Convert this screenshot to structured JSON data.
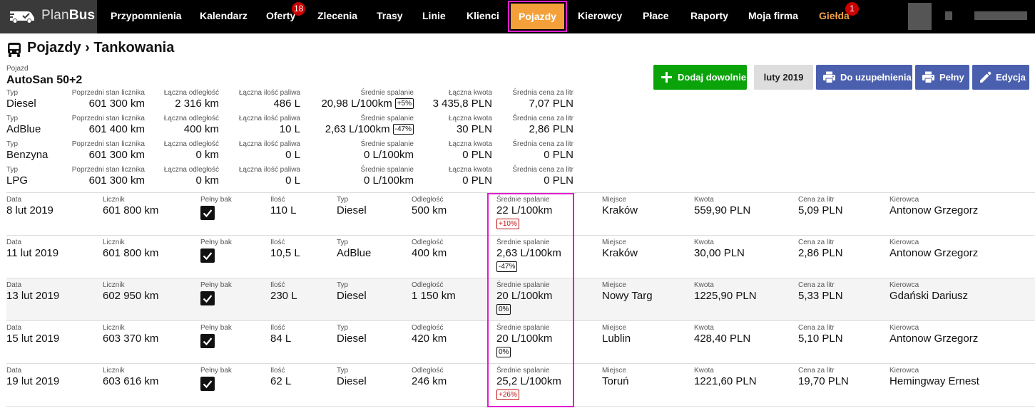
{
  "nav": {
    "logo_plan": "Plan",
    "logo_bus": "Bus",
    "items": [
      {
        "label": "Przypomnienia"
      },
      {
        "label": "Kalendarz"
      },
      {
        "label": "Oferty",
        "badge": "18"
      },
      {
        "label": "Zlecenia"
      },
      {
        "label": "Trasy"
      },
      {
        "label": "Linie"
      },
      {
        "label": "Klienci"
      },
      {
        "label": "Pojazdy",
        "active": true
      },
      {
        "label": "Kierowcy"
      },
      {
        "label": "Płace"
      },
      {
        "label": "Raporty"
      },
      {
        "label": "Moja firma"
      },
      {
        "label": "Giełda",
        "badge": "1"
      }
    ],
    "active_color": "#f4a03a",
    "gielda_color": "#f5a142"
  },
  "header": {
    "title": "Pojazdy › Tankowania",
    "vehicle_label": "Pojazd",
    "vehicle_name": "AutoSan 50+2"
  },
  "buttons": {
    "add": "Dodaj dowolnie",
    "month": "luty 2019",
    "refill": "Do uzupełnienia",
    "full": "Pełny",
    "edit": "Edycja"
  },
  "summary_labels": {
    "type": "Typ",
    "prev_odo": "Poprzedni stan licznika",
    "total_distance": "Łączna odległość",
    "total_fuel": "Łączna ilość paliwa",
    "avg_consumption": "Średnie spalanie",
    "total_amount": "Łączna kwota",
    "avg_price": "Średnia cena za litr"
  },
  "summary": [
    {
      "type": "Diesel",
      "prev_odo": "601 300 km",
      "distance": "2 316 km",
      "fuel": "486 L",
      "consumption": "20,98 L/100km",
      "pct": "+5%",
      "amount": "3 435,8 PLN",
      "price": "7,07 PLN"
    },
    {
      "type": "AdBlue",
      "prev_odo": "601 400 km",
      "distance": "400 km",
      "fuel": "10 L",
      "consumption": "2,63 L/100km",
      "pct": "-47%",
      "amount": "30 PLN",
      "price": "2,86 PLN"
    },
    {
      "type": "Benzyna",
      "prev_odo": "601 300 km",
      "distance": "0 km",
      "fuel": "0 L",
      "consumption": "0 L/100km",
      "pct": "",
      "amount": "0 PLN",
      "price": "0 PLN"
    },
    {
      "type": "LPG",
      "prev_odo": "601 300 km",
      "distance": "0 km",
      "fuel": "0 L",
      "consumption": "0 L/100km",
      "pct": "",
      "amount": "0 PLN",
      "price": "0 PLN"
    }
  ],
  "row_labels": {
    "date": "Data",
    "odo": "Licznik",
    "full": "Pełny bak",
    "qty": "Ilość",
    "type": "Typ",
    "distance": "Odległość",
    "consumption": "Średnie spalanie",
    "place": "Miejsce",
    "amount": "Kwota",
    "price": "Cena za litr",
    "driver": "Kierowca"
  },
  "refuels": [
    {
      "date": "8 lut 2019",
      "odo": "601 800 km",
      "full": true,
      "qty": "110 L",
      "type": "Diesel",
      "distance": "500 km",
      "consumption": "22 L/100km",
      "delta": "+10%",
      "delta_up": true,
      "place": "Kraków",
      "amount": "559,90 PLN",
      "price": "5,09 PLN",
      "driver": "Antonow Grzegorz"
    },
    {
      "date": "11 lut 2019",
      "odo": "601 800 km",
      "full": true,
      "qty": "10,5 L",
      "type": "AdBlue",
      "distance": "400 km",
      "consumption": "2,63 L/100km",
      "delta": "-47%",
      "delta_up": false,
      "place": "Kraków",
      "amount": "30,00 PLN",
      "price": "2,86 PLN",
      "driver": "Antonow Grzegorz"
    },
    {
      "date": "13 lut 2019",
      "odo": "602 950 km",
      "full": true,
      "qty": "230 L",
      "type": "Diesel",
      "distance": "1 150 km",
      "consumption": "20 L/100km",
      "delta": "0%",
      "delta_up": false,
      "place": "Nowy Targ",
      "amount": "1225,90 PLN",
      "price": "5,33 PLN",
      "driver": "Gdański Dariusz"
    },
    {
      "date": "15 lut 2019",
      "odo": "603 370 km",
      "full": true,
      "qty": "84 L",
      "type": "Diesel",
      "distance": "420 km",
      "consumption": "20 L/100km",
      "delta": "0%",
      "delta_up": false,
      "place": "Lublin",
      "amount": "428,40 PLN",
      "price": "5,10 PLN",
      "driver": "Antonow Grzegorz"
    },
    {
      "date": "19 lut 2019",
      "odo": "603 616 km",
      "full": true,
      "qty": "62 L",
      "type": "Diesel",
      "distance": "246 km",
      "consumption": "25,2 L/100km",
      "delta": "+26%",
      "delta_up": true,
      "place": "Toruń",
      "amount": "1221,60 PLN",
      "price": "19,70 PLN",
      "driver": "Hemingway Ernest"
    }
  ]
}
